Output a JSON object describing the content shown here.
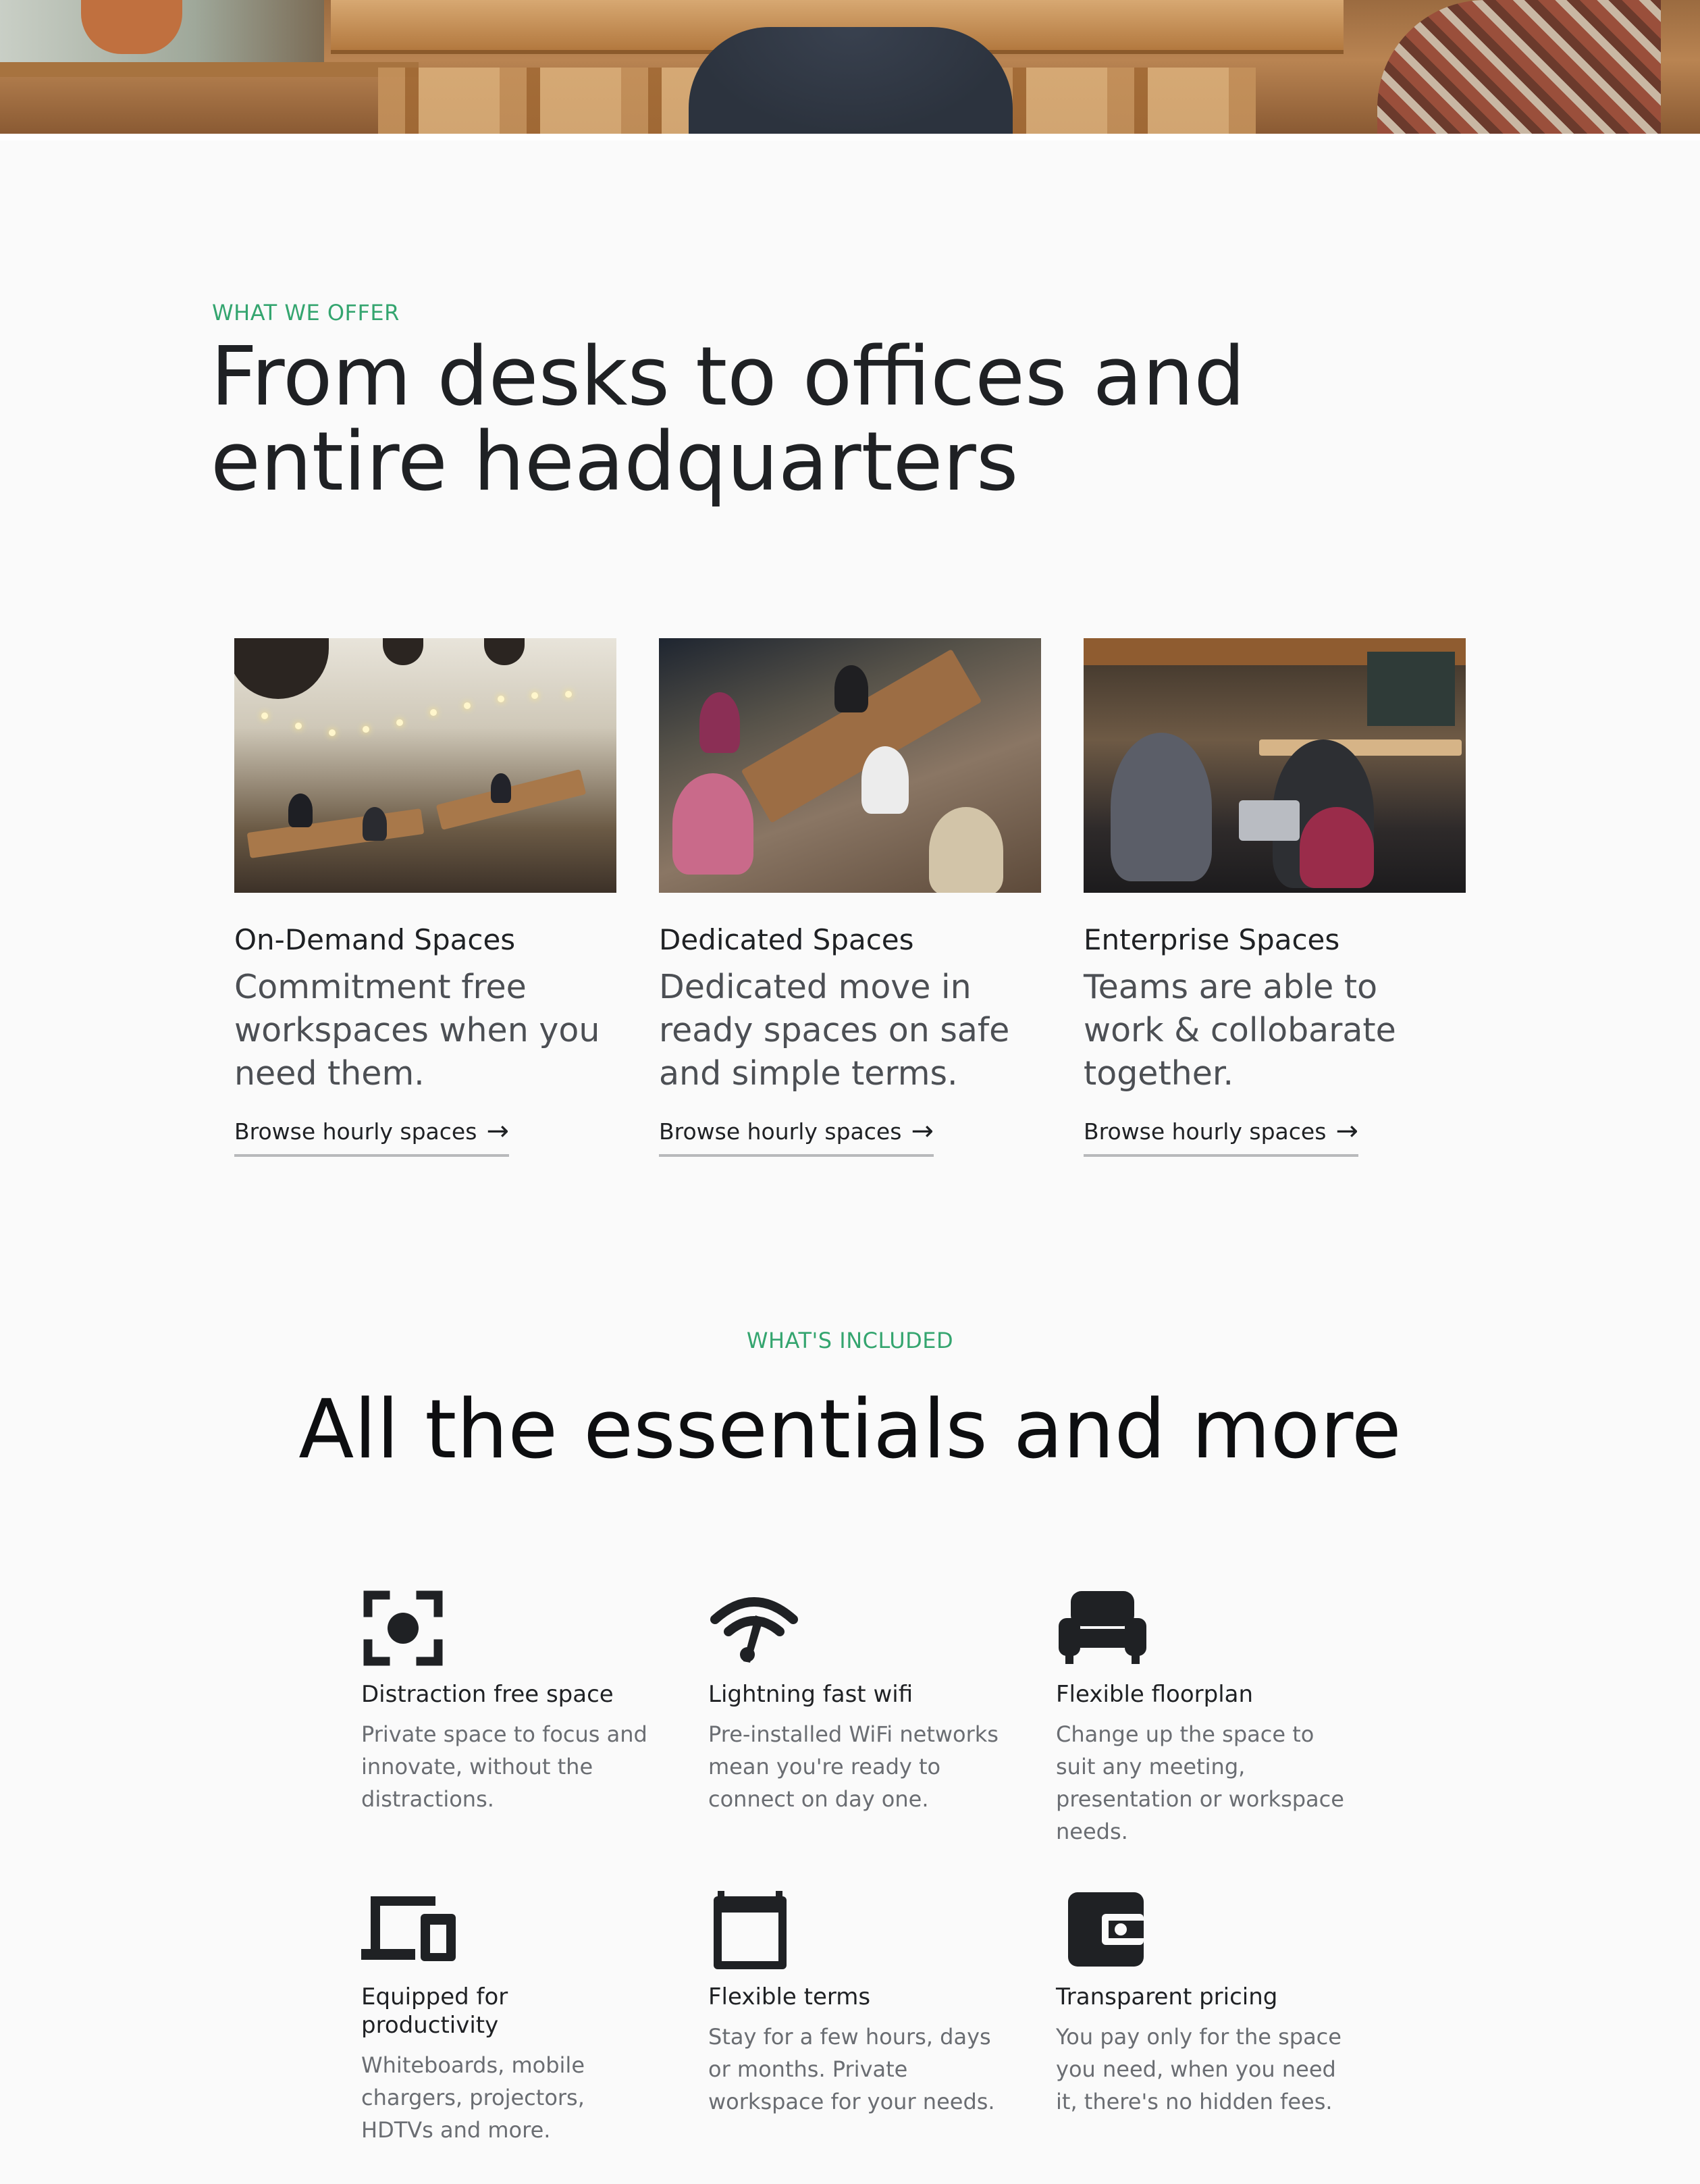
{
  "offer": {
    "eyebrow": "WHAT WE OFFER",
    "heading_line1": "From desks to offices and",
    "heading_line2": "entire headquarters",
    "cards": [
      {
        "title": "On-Demand Spaces",
        "description": "Commitment free workspaces when you need them.",
        "link_label": "Browse hourly spaces",
        "image": "open-coworking-hall-photo"
      },
      {
        "title": "Dedicated Spaces",
        "description": "Dedicated move in ready spaces on safe and simple terms.",
        "link_label": "Browse hourly spaces",
        "image": "team-at-shared-table-photo"
      },
      {
        "title": "Enterprise Spaces",
        "description": "Teams are able to work & collobarate together.",
        "link_label": "Browse hourly spaces",
        "image": "colleagues-lounge-photo"
      }
    ]
  },
  "included": {
    "eyebrow": "WHAT'S INCLUDED",
    "heading": "All the essentials and more",
    "features": [
      {
        "icon": "focus-target-icon",
        "title": "Distraction free space",
        "description": "Private space to focus and innovate, without the distractions."
      },
      {
        "icon": "wifi-icon",
        "title": "Lightning fast wifi",
        "description": "Pre-installed WiFi networks mean you're ready to connect on day one."
      },
      {
        "icon": "sofa-icon",
        "title": "Flexible floorplan",
        "description": "Change up the space to suit any meeting, presentation or workspace needs."
      },
      {
        "icon": "devices-icon",
        "title": "Equipped for productivity",
        "description": "Whiteboards, mobile chargers, projectors, HDTVs and more."
      },
      {
        "icon": "calendar-icon",
        "title": "Flexible terms",
        "description": "Stay for a few hours, days or months. Private workspace for your needs."
      },
      {
        "icon": "wallet-icon",
        "title": "Transparent pricing",
        "description": "You pay only for the space you need, when you need it, there's no hidden fees."
      }
    ]
  },
  "colors": {
    "accent": "#34a56f",
    "heading": "#1f2124",
    "body_text": "#4c4f54",
    "muted_text": "#6a6d72",
    "background": "#fafafa"
  }
}
